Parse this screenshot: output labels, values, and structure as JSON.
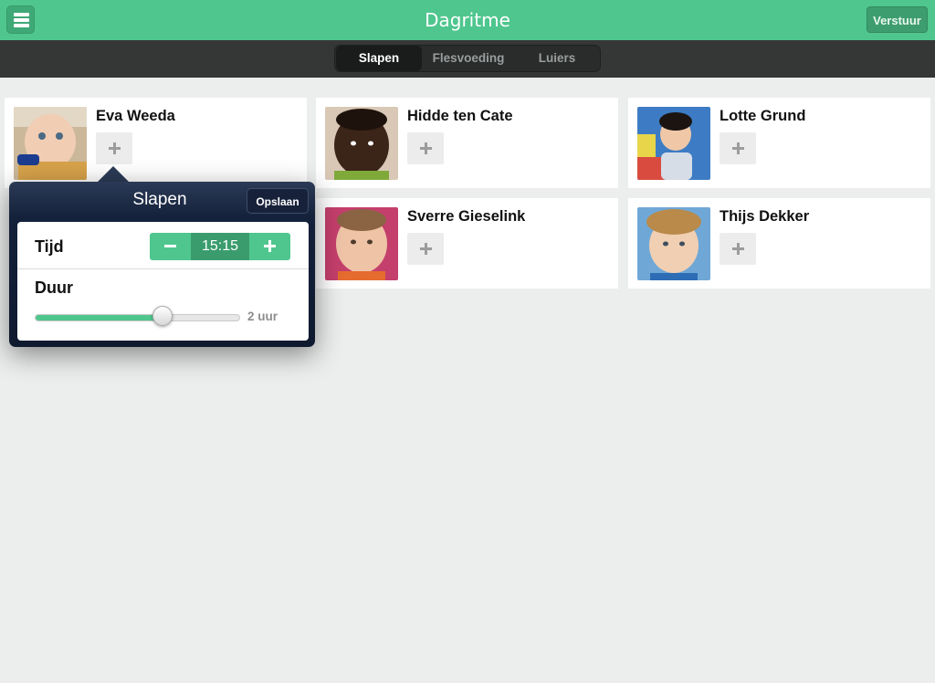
{
  "header": {
    "title": "Dagritme",
    "send_label": "Verstuur"
  },
  "tabs": [
    {
      "label": "Slapen",
      "active": true
    },
    {
      "label": "Flesvoeding",
      "active": false
    },
    {
      "label": "Luiers",
      "active": false
    }
  ],
  "children": [
    {
      "name": "Eva Weeda"
    },
    {
      "name": "Hidde ten Cate"
    },
    {
      "name": "Lotte Grund"
    },
    {
      "name": "Sverre Gieselink"
    },
    {
      "name": "Thijs Dekker"
    }
  ],
  "popover": {
    "title": "Slapen",
    "save_label": "Opslaan",
    "time_label": "Tijd",
    "time_value": "15:15",
    "duration_label": "Duur",
    "duration_value": "2 uur",
    "duration_slider_fraction": 0.62
  },
  "colors": {
    "accent": "#4fc68e",
    "accent_dark": "#3a9c6d",
    "segbar": "#353737",
    "popover": "#14213a"
  },
  "icons": [
    "menu-icon",
    "plus-icon",
    "minus-icon"
  ]
}
